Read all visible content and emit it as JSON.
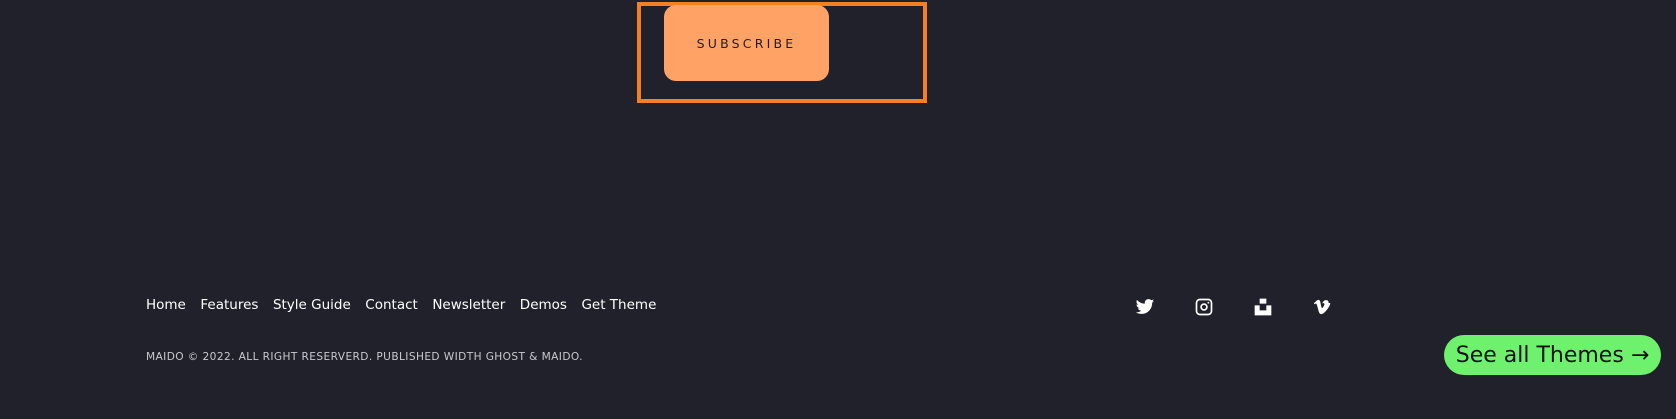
{
  "newsletter": {
    "subscribe_label": "SUBSCRIBE"
  },
  "footer": {
    "nav": [
      {
        "label": "Home"
      },
      {
        "label": "Features"
      },
      {
        "label": "Style Guide"
      },
      {
        "label": "Contact"
      },
      {
        "label": "Newsletter"
      },
      {
        "label": "Demos"
      },
      {
        "label": "Get Theme"
      }
    ],
    "copyright": "MAIDO © 2022. ALL RIGHT RESERVERD. PUBLISHED WIDTH GHOST & MAIDO.",
    "social": [
      {
        "icon": "twitter-icon"
      },
      {
        "icon": "instagram-icon"
      },
      {
        "icon": "unsplash-icon"
      },
      {
        "icon": "vimeo-icon"
      }
    ]
  },
  "promo": {
    "see_all_themes_label": "See all Themes",
    "arrow": "→"
  },
  "colors": {
    "background": "#21212b",
    "highlight_border": "#f47f24",
    "subscribe_button": "#ffa266",
    "themes_button": "#6ef26e"
  }
}
